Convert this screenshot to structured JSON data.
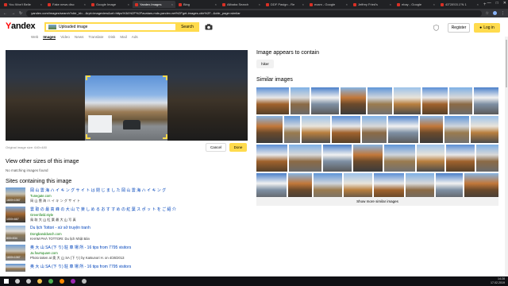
{
  "browser": {
    "tabs": [
      {
        "label": "You Won't Belie",
        "active": false
      },
      {
        "label": "Fake news disc",
        "active": false
      },
      {
        "label": "Google Image",
        "active": false
      },
      {
        "label": "Yandex.Images",
        "active": true
      },
      {
        "label": "Bing",
        "active": false
      },
      {
        "label": "Alibaba Search",
        "active": false
      },
      {
        "label": "DDF Pasign - Re",
        "active": false
      },
      {
        "label": "exam - Google",
        "active": false
      },
      {
        "label": "Jeffrey Fried's",
        "active": false
      },
      {
        "label": "ebay - Google",
        "active": false
      },
      {
        "label": "43°28'03.1\"N 1",
        "active": false
      }
    ],
    "url": "yandex.com/images/search?cbir_id=...&rpt=imageview&url=https%3A%2F%2Favatars.mds.yandex.net%2Fget-images-cbir%2F...&cbir_page=similar"
  },
  "header": {
    "logo_text": "Yandex",
    "search_value": "Uploaded image",
    "search_button": "Search",
    "register": "Register",
    "login": "Log in",
    "nav": [
      "Web",
      "Images",
      "Video",
      "News",
      "Translate",
      "Disk",
      "Mail",
      "Ads"
    ]
  },
  "cropper": {
    "original_size": "Original image size: 640×480",
    "cancel": "Cancel",
    "done": "Done"
  },
  "left": {
    "other_sizes_title": "View other sizes of this image",
    "no_matching": "No matching images found",
    "sites_title": "Sites containing this image",
    "sites": [
      {
        "title": "岡 山 雲 海 ハ イ キ ン グ サ イ ト は 閉 じ ま し た 岡 山 雲 海 ハ イ キ ン グ",
        "domain": "Tunegate.com",
        "snippet": "岡 山 雲 海 ハ イ キ ン グ サ イ ト",
        "dims": "1600×1067"
      },
      {
        "title": "雲 取 の 最 高 峰 の 大 山 で 楽 し め る お す す め の 紅 葉 ス ポ ッ ト を ご 紹 介",
        "domain": "Greenfield.style",
        "snippet": "鳥 取 大 山 紅 葉 最 大 山 写 真",
        "dims": "1000×667"
      },
      {
        "title": "Du lịch Tottori - xứ sở truyện tranh",
        "domain": "Dongbanddusch.com",
        "snippet": "KHÁM PHÁ TOTTORI: Du lịch Nhật Bản",
        "dims": "800×534"
      },
      {
        "title": "奥 大 山 SA (下 り) 駐 車 場 所 - 16 tips from 7795 visitors",
        "domain": "Ja.foursquare.com",
        "snippet": "Photo taken at 奥 大 山 SA (下 り) by Katsunori H. on 4/26/2013",
        "dims": "1600×1067"
      },
      {
        "title": "奥 大 山 SA (下 り) 駐 車 場 所 - 16 tips from 7795 visitors",
        "domain": "",
        "snippet": "",
        "dims": ""
      }
    ]
  },
  "right": {
    "appears_title": "Image appears to contain",
    "tag": "hiker",
    "similar_title": "Similar images",
    "show_more": "Show more similar images"
  },
  "taskbar": {
    "time": "14:28",
    "date": "17.02.2019"
  }
}
